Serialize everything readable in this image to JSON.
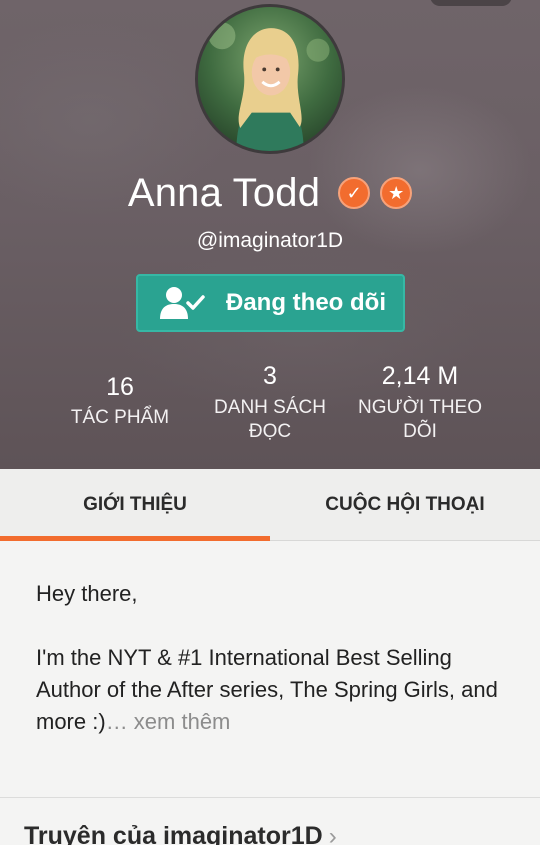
{
  "profile": {
    "name": "Anna Todd",
    "handle": "@imaginator1D",
    "badges": {
      "verified_icon": "check-badge-icon",
      "star_icon": "star-badge-icon",
      "color": "#f26c2e"
    },
    "follow_label": "Đang theo dõi",
    "follow_icon": "user-check-icon",
    "accent": "#2aa391"
  },
  "stats": {
    "works": {
      "value": "16",
      "label": "TÁC PHẨM"
    },
    "reading_lists": {
      "value": "3",
      "label_line1": "DANH SÁCH",
      "label_line2": "ĐỌC"
    },
    "followers": {
      "value": "2,14 M",
      "label_line1": "NGƯỜI THEO",
      "label_line2": "DÕI"
    }
  },
  "tabs": {
    "about": "GIỚI THIỆU",
    "conversations": "CUỘC HỘI THOẠI",
    "active": "about",
    "underline_color": "#f26c2e"
  },
  "about": {
    "greeting": "Hey there,",
    "bio": "I'm the NYT & #1 International Best Selling Author of the After series, The Spring Girls, and more :)",
    "more_label": "… xem thêm"
  },
  "stories": {
    "title": "Truyện của imaginator1D",
    "chevron": "›"
  }
}
